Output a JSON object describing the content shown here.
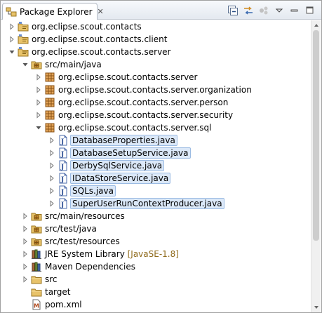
{
  "view": {
    "tab_title": "Package Explorer",
    "close_glyph": "✕",
    "toolbar": {
      "collapse_all_icon": "collapse-all-icon",
      "link_editor_icon": "link-with-editor-icon",
      "focus_icon": "focus-on-active-task-icon",
      "view_menu_icon": "view-menu-icon",
      "minimize_icon": "minimize-icon",
      "maximize_icon": "maximize-icon"
    }
  },
  "tree": [
    {
      "label": "org.eclipse.scout.contacts",
      "icon": "project-icon",
      "state": "collapsed",
      "level": 0
    },
    {
      "label": "org.eclipse.scout.contacts.client",
      "icon": "project-icon",
      "state": "collapsed",
      "level": 0
    },
    {
      "label": "org.eclipse.scout.contacts.server",
      "icon": "project-icon",
      "state": "expanded",
      "level": 0
    },
    {
      "label": "src/main/java",
      "icon": "source-folder-icon",
      "state": "expanded",
      "level": 1
    },
    {
      "label": "org.eclipse.scout.contacts.server",
      "icon": "package-icon",
      "state": "collapsed",
      "level": 2
    },
    {
      "label": "org.eclipse.scout.contacts.server.organization",
      "icon": "package-icon",
      "state": "collapsed",
      "level": 2
    },
    {
      "label": "org.eclipse.scout.contacts.server.person",
      "icon": "package-icon",
      "state": "collapsed",
      "level": 2
    },
    {
      "label": "org.eclipse.scout.contacts.server.security",
      "icon": "package-icon",
      "state": "collapsed",
      "level": 2
    },
    {
      "label": "org.eclipse.scout.contacts.server.sql",
      "icon": "package-icon",
      "state": "expanded",
      "level": 2
    },
    {
      "label": "DatabaseProperties.java",
      "icon": "java-file-icon",
      "state": "collapsed",
      "level": 3,
      "selected": true
    },
    {
      "label": "DatabaseSetupService.java",
      "icon": "java-file-icon",
      "state": "collapsed",
      "level": 3,
      "selected": true
    },
    {
      "label": "DerbySqlService.java",
      "icon": "java-file-icon",
      "state": "collapsed",
      "level": 3,
      "selected": true
    },
    {
      "label": "IDataStoreService.java",
      "icon": "java-file-icon",
      "state": "collapsed",
      "level": 3,
      "selected": true
    },
    {
      "label": "SQLs.java",
      "icon": "java-file-icon",
      "state": "collapsed",
      "level": 3,
      "selected": true
    },
    {
      "label": "SuperUserRunContextProducer.java",
      "icon": "java-file-icon",
      "state": "collapsed",
      "level": 3,
      "selected": true
    },
    {
      "label": "src/main/resources",
      "icon": "source-folder-icon",
      "state": "collapsed",
      "level": 1
    },
    {
      "label": "src/test/java",
      "icon": "source-folder-icon",
      "state": "collapsed",
      "level": 1
    },
    {
      "label": "src/test/resources",
      "icon": "source-folder-icon",
      "state": "collapsed",
      "level": 1
    },
    {
      "label": "JRE System Library",
      "decoration": "[JavaSE-1.8]",
      "icon": "library-icon",
      "state": "collapsed",
      "level": 1
    },
    {
      "label": "Maven Dependencies",
      "icon": "library-icon",
      "state": "collapsed",
      "level": 1
    },
    {
      "label": "src",
      "icon": "folder-icon",
      "state": "collapsed",
      "level": 1
    },
    {
      "label": "target",
      "icon": "folder-icon",
      "state": "none",
      "level": 1
    },
    {
      "label": "pom.xml",
      "icon": "maven-file-icon",
      "state": "none",
      "level": 1
    }
  ]
}
